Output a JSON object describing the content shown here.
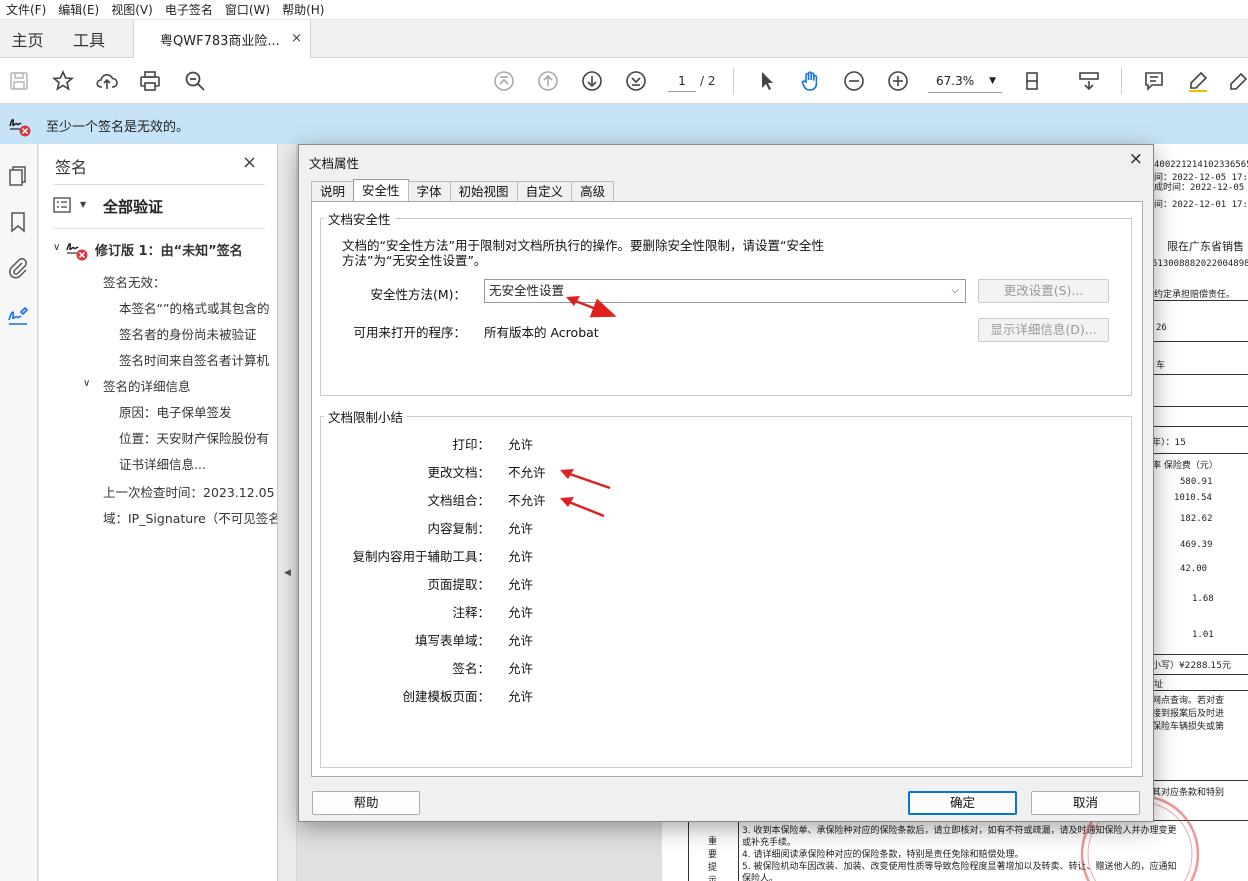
{
  "menu": [
    "文件(F)",
    "编辑(E)",
    "视图(V)",
    "电子签名",
    "窗口(W)",
    "帮助(H)"
  ],
  "tabs": {
    "home": "主页",
    "tools": "工具",
    "document": "粤QWF783商业险...",
    "close": "×"
  },
  "toolbar": {
    "page_current": "1",
    "page_total": "/ 2",
    "zoom": "67.3%"
  },
  "notification": {
    "message": "至少一个签名是无效的。"
  },
  "signature_panel": {
    "title": "签名",
    "close": "×",
    "verify_all": "全部验证",
    "revision": "修订版 1：由“未知”签名",
    "invalid": "签名无效：",
    "invalid_details": [
      "本签名“”的格式或其包含的",
      "签名者的身份尚未被验证",
      "签名时间来自签名者计算机"
    ],
    "details_header": "签名的详细信息",
    "details": [
      "原因：电子保单签发",
      "位置：天安财产保险股份有",
      "证书详细信息..."
    ],
    "last_checked": "上一次检查时间：2023.12.05 2",
    "field": "域：IP_Signature（不可见签名"
  },
  "dialog": {
    "title": "文档属性",
    "close": "×",
    "tabs": [
      "说明",
      "安全性",
      "字体",
      "初始视图",
      "自定义",
      "高级"
    ],
    "active_tab": "安全性",
    "security_group": {
      "label": "文档安全性",
      "description_line1": "文档的“安全性方法”用于限制对文档所执行的操作。要删除安全性限制，请设置“安全性",
      "description_line2": "方法”为“无安全性设置”。",
      "method_label": "安全性方法(M)：",
      "method_value": "无安全性设置",
      "change_settings": "更改设置(S)...",
      "open_with_label": "可用来打开的程序：",
      "open_with_value": "所有版本的 Acrobat",
      "show_details": "显示详细信息(D)..."
    },
    "restrictions_group": {
      "label": "文档限制小结",
      "rows": [
        {
          "label": "打印：",
          "value": "允许"
        },
        {
          "label": "更改文档：",
          "value": "不允许"
        },
        {
          "label": "文档组合：",
          "value": "不允许"
        },
        {
          "label": "内容复制：",
          "value": "允许"
        },
        {
          "label": "复制内容用于辅助工具：",
          "value": "允许"
        },
        {
          "label": "页面提取：",
          "value": "允许"
        },
        {
          "label": "注释：",
          "value": "允许"
        },
        {
          "label": "填写表单域：",
          "value": "允许"
        },
        {
          "label": "签名：",
          "value": "允许"
        },
        {
          "label": "创建模板页面：",
          "value": "允许"
        }
      ]
    },
    "help_button": "帮助",
    "ok_button": "确定",
    "cancel_button": "取消"
  },
  "document_snippets": {
    "lines": [
      "40022121410233656518",
      "间：2022-12-05 17:47:36",
      "成时间：2022-12-05",
      "间：2022-12-01 17:24:07",
      "限在广东省销售",
      "5130088820220048983",
      "约定承担赔偿责任。",
      "26",
      "车",
      "年）：15",
      "率  保险费（元）",
      "580.91",
      "1010.54",
      "182.62",
      "469.39",
      "42.00",
      "1.68",
      "1.01",
      "小写）¥2288.15元",
      "址",
      "网点查询。若对查",
      "接到报案后及时进",
      "保险车辆损失或第",
      "其对应条款和特别",
      "3. 收到本保险单、承保险种对应的保险条款后，请立即核对，如有不符或疏漏，请及时通知保险人并办理变更",
      "或补充手续。",
      "4. 请详细阅读承保险种对应的保险条款，特别是责任免除和赔偿处理。",
      "5. 被保险机动车因改装、加装、改变使用性质等导致危险程度显著增加以及转卖、转让、赠送他人的，应通知",
      "保险人。",
      "重",
      "要",
      "提",
      "示"
    ]
  },
  "colors": {
    "notify_bg": "#c7e3f7",
    "accent": "#0078d4",
    "arrow_red": "#e02020"
  }
}
